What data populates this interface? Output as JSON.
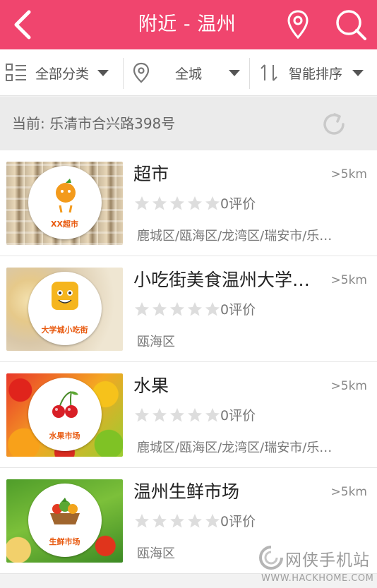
{
  "header": {
    "title": "附近 - 温州",
    "bg_color": "#f0456e",
    "back_icon": "chevron-left-icon",
    "location_icon": "map-pin-icon",
    "search_icon": "search-icon"
  },
  "filters": [
    {
      "label": "全部分类",
      "icon": "grid-list-icon"
    },
    {
      "label": "全城",
      "icon": "map-pin-icon"
    },
    {
      "label": "智能排序",
      "icon": "sort-icon"
    }
  ],
  "current_location": {
    "text": "当前: 乐清市合兴路398号",
    "icon": "refresh-icon"
  },
  "items": [
    {
      "name": "超市",
      "distance": ">5km",
      "rating": 0,
      "reviews": "0评价",
      "area": "鹿城区/瓯海区/龙湾区/瑞安市/乐…",
      "logo_text": "XX超市"
    },
    {
      "name": "小吃街美食温州大学…",
      "distance": ">5km",
      "rating": 0,
      "reviews": "0评价",
      "area": "瓯海区",
      "logo_text": "大学城小吃街"
    },
    {
      "name": "水果",
      "distance": ">5km",
      "rating": 0,
      "reviews": "0评价",
      "area": "鹿城区/瓯海区/龙湾区/瑞安市/乐…",
      "logo_text": "水果市场"
    },
    {
      "name": "温州生鲜市场",
      "distance": ">5km",
      "rating": 0,
      "reviews": "0评价",
      "area": "瓯海区",
      "logo_text": "生鲜市场"
    }
  ],
  "watermark": {
    "cn": "网侠手机站",
    "en": "WWW.HACKHOME.COM"
  }
}
